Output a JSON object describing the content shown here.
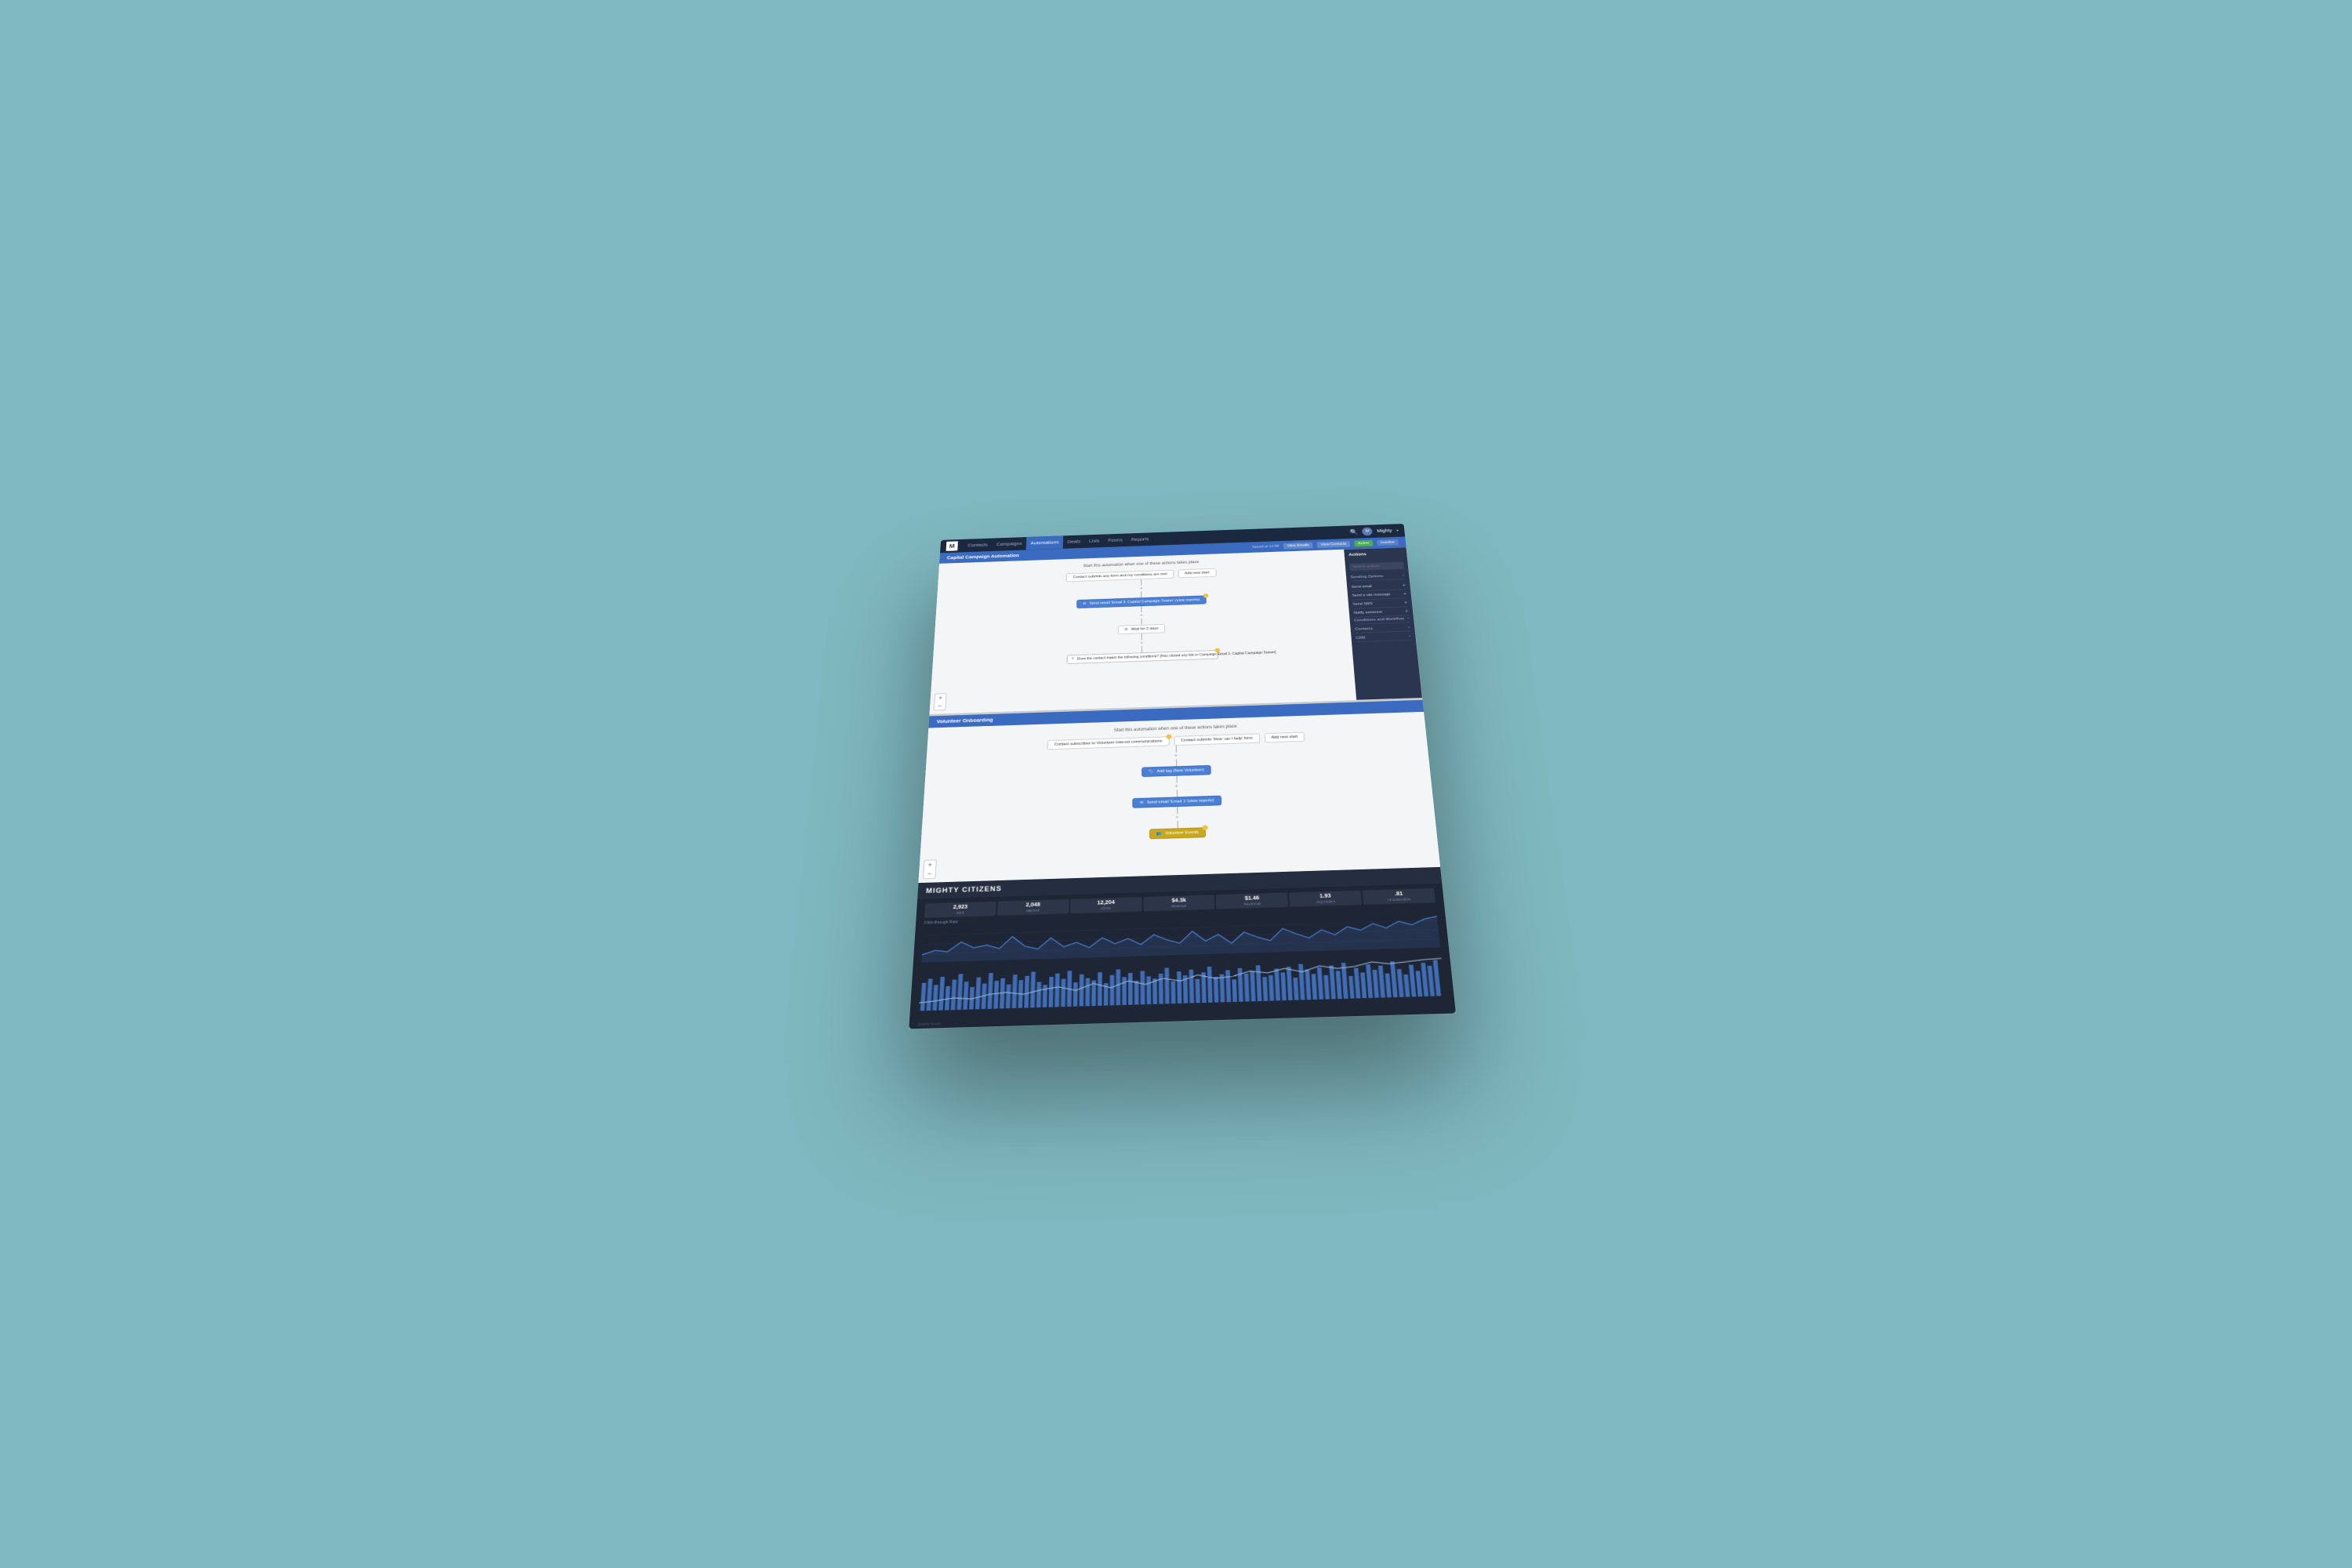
{
  "app": {
    "logo": "M",
    "nav": {
      "items": [
        {
          "label": "Contacts",
          "active": false
        },
        {
          "label": "Campaigns",
          "active": false
        },
        {
          "label": "Automations",
          "active": true
        },
        {
          "label": "Deals",
          "active": false
        },
        {
          "label": "Lists",
          "active": false
        },
        {
          "label": "Forms",
          "active": false
        },
        {
          "label": "Reports",
          "active": false
        }
      ],
      "username": "Mighty",
      "search_placeholder": "Search..."
    }
  },
  "panel_top": {
    "title": "Capital Campaign Automation",
    "saved_info": "Saved at 12:08",
    "buttons": {
      "view_emails": "View Emails",
      "view_contacts": "View Contacts",
      "active": "Active",
      "inactive": "Inactive"
    },
    "canvas": {
      "trigger_text": "Start this automation when one of these actions takes place",
      "nodes": [
        {
          "text": "Contact submits any form and my conditions are met",
          "type": "trigger"
        },
        {
          "text": "Add new start",
          "type": "add"
        },
        {
          "text": "Send email 'Email 1: Capital Campaign Teaser' (view reports)",
          "type": "action-blue"
        },
        {
          "text": "Wait for 2 days",
          "type": "wait"
        },
        {
          "text": "Does the contact match the following conditions? [Has clicked any link in Campaign Email 1: Capital Campaign Teaser]",
          "type": "condition"
        }
      ]
    },
    "actions": {
      "title": "Actions",
      "search_placeholder": "Search actions",
      "sections": [
        {
          "title": "Sending Options",
          "items": [
            "Send email",
            "Send a site message",
            "Send SMS",
            "Notify someone"
          ]
        },
        {
          "title": "Conditions and Workflow",
          "items": []
        },
        {
          "title": "Contacts",
          "items": []
        },
        {
          "title": "CRM",
          "items": []
        }
      ]
    }
  },
  "panel_middle": {
    "title": "Volunteer Onboarding",
    "canvas": {
      "trigger_text": "Start this automation when one of these actions takes place",
      "nodes": [
        {
          "text": "Contact subscribes to Volunteer Interest communications",
          "type": "trigger"
        },
        {
          "text": "Contact submits 'How can I help' form",
          "type": "trigger"
        },
        {
          "text": "Add new start",
          "type": "add"
        },
        {
          "text": "Add tag (New Volunteer)",
          "type": "action-blue"
        },
        {
          "text": "Send email 'Email 1' (view reports)",
          "type": "action-blue"
        },
        {
          "text": "Volunteer Events",
          "type": "action-yellow"
        }
      ]
    }
  },
  "panel_bottom": {
    "brand": "MIGHTY CITIZENS",
    "stats": [
      {
        "value": "2,923",
        "label": "Sent"
      },
      {
        "value": "2,048",
        "label": "Opened"
      },
      {
        "value": "12,204",
        "label": "Clicks"
      },
      {
        "value": "$4.3k",
        "label": "Revenue"
      },
      {
        "value": "$1.46",
        "label": "Rev/Email"
      },
      {
        "value": "1.93",
        "label": "Avg Orders"
      },
      {
        "value": ".81",
        "label": "Unsubscribes"
      }
    ],
    "chart": {
      "title": "Click-through Rate",
      "quality_score_label": "Quality Score"
    }
  }
}
